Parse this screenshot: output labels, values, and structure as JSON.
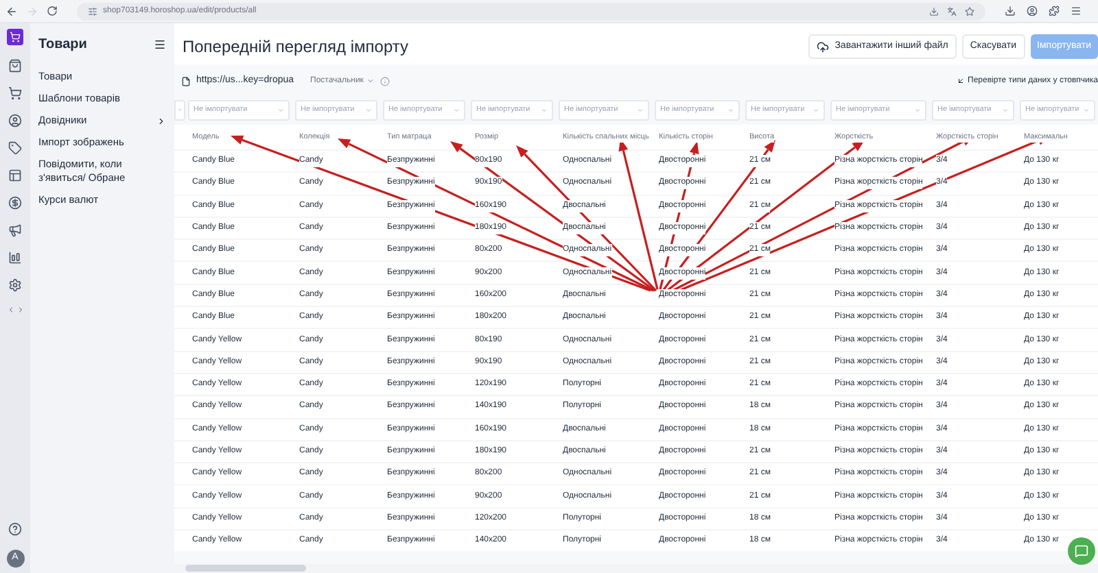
{
  "browser": {
    "url": "shop703149.horoshop.ua/edit/products/all"
  },
  "sidebar": {
    "title": "Товари",
    "items": [
      {
        "label": "Товари",
        "expandable": false
      },
      {
        "label": "Шаблони товарів",
        "expandable": false
      },
      {
        "label": "Довідники",
        "expandable": true
      },
      {
        "label": "Імпорт зображень",
        "expandable": false
      },
      {
        "label": "Повідомити, коли з'явиться/ Обране",
        "expandable": false
      },
      {
        "label": "Курси валют",
        "expandable": false
      }
    ]
  },
  "user": {
    "initial": "A"
  },
  "page": {
    "title": "Попередній перегляд імпорту",
    "buttons": [
      {
        "label": "Завантажити інший файл",
        "kind": "upload",
        "disabled": false
      },
      {
        "label": "Скасувати",
        "kind": "secondary",
        "disabled": false
      },
      {
        "label": "Імпортувати",
        "kind": "primary",
        "disabled": true
      }
    ]
  },
  "toolbar": {
    "file": "https://us...key=dropua",
    "supplier": "Постачальник",
    "hint": "Перевірте типи даних у стовпчика"
  },
  "table": {
    "columns": [
      {
        "name": "Модель",
        "mapping": "Не імпортувати"
      },
      {
        "name": "Колекція",
        "mapping": "Не імпортувати"
      },
      {
        "name": "Тип матраца",
        "mapping": "Не імпортувати"
      },
      {
        "name": "Розмір",
        "mapping": "Не імпортувати"
      },
      {
        "name": "Кількість спальних місць",
        "mapping": "Не імпортувати"
      },
      {
        "name": "Кількість сторін",
        "mapping": "Не імпортувати"
      },
      {
        "name": "Висота",
        "mapping": "Не імпортувати"
      },
      {
        "name": "Жорсткість",
        "mapping": "Не імпортувати"
      },
      {
        "name": "Жорсткість сторін",
        "mapping": "Не імпортувати"
      },
      {
        "name": "Максимальн",
        "mapping": "Не імпортувати"
      }
    ],
    "rows": [
      [
        "Candy Blue",
        "Candy",
        "Безпружинні",
        "80x190",
        "Односпальні",
        "Двосторонні",
        "21 см",
        "Різна жорсткість сторін",
        "3/4",
        "До 130 кг"
      ],
      [
        "Candy Blue",
        "Candy",
        "Безпружинні",
        "90x190",
        "Односпальні",
        "Двосторонні",
        "21 см",
        "Різна жорсткість сторін",
        "3/4",
        "До 130 кг"
      ],
      [
        "Candy Blue",
        "Candy",
        "Безпружинні",
        "160x190",
        "Двоспальні",
        "Двосторонні",
        "21 см",
        "Різна жорсткість сторін",
        "3/4",
        "До 130 кг"
      ],
      [
        "Candy Blue",
        "Candy",
        "Безпружинні",
        "180x190",
        "Двоспальні",
        "Двосторонні",
        "21 см",
        "Різна жорсткість сторін",
        "3/4",
        "До 130 кг"
      ],
      [
        "Candy Blue",
        "Candy",
        "Безпружинні",
        "80x200",
        "Односпальні",
        "Двосторонні",
        "21 см",
        "Різна жорсткість сторін",
        "3/4",
        "До 130 кг"
      ],
      [
        "Candy Blue",
        "Candy",
        "Безпружинні",
        "90x200",
        "Односпальні",
        "Двосторонні",
        "21 см",
        "Різна жорсткість сторін",
        "3/4",
        "До 130 кг"
      ],
      [
        "Candy Blue",
        "Candy",
        "Безпружинні",
        "160x200",
        "Двоспальні",
        "Двосторонні",
        "21 см",
        "Різна жорсткість сторін",
        "3/4",
        "До 130 кг"
      ],
      [
        "Candy Blue",
        "Candy",
        "Безпружинні",
        "180x200",
        "Двоспальні",
        "Двосторонні",
        "21 см",
        "Різна жорсткість сторін",
        "3/4",
        "До 130 кг"
      ],
      [
        "Candy Yellow",
        "Candy",
        "Безпружинні",
        "80x190",
        "Односпальні",
        "Двосторонні",
        "21 см",
        "Різна жорсткість сторін",
        "3/4",
        "До 130 кг"
      ],
      [
        "Candy Yellow",
        "Candy",
        "Безпружинні",
        "90x190",
        "Односпальні",
        "Двосторонні",
        "21 см",
        "Різна жорсткість сторін",
        "3/4",
        "До 130 кг"
      ],
      [
        "Candy Yellow",
        "Candy",
        "Безпружинні",
        "120x190",
        "Полуторні",
        "Двосторонні",
        "21 см",
        "Різна жорсткість сторін",
        "3/4",
        "До 130 кг"
      ],
      [
        "Candy Yellow",
        "Candy",
        "Безпружинні",
        "140x190",
        "Полуторні",
        "Двосторонні",
        "18 см",
        "Різна жорсткість сторін",
        "3/4",
        "До 130 кг"
      ],
      [
        "Candy Yellow",
        "Candy",
        "Безпружинні",
        "160x190",
        "Двоспальні",
        "Двосторонні",
        "18 см",
        "Різна жорсткість сторін",
        "3/4",
        "До 130 кг"
      ],
      [
        "Candy Yellow",
        "Candy",
        "Безпружинні",
        "180x190",
        "Двоспальні",
        "Двосторонні",
        "21 см",
        "Різна жорсткість сторін",
        "3/4",
        "До 130 кг"
      ],
      [
        "Candy Yellow",
        "Candy",
        "Безпружинні",
        "80x200",
        "Односпальні",
        "Двосторонні",
        "21 см",
        "Різна жорсткість сторін",
        "3/4",
        "До 130 кг"
      ],
      [
        "Candy Yellow",
        "Candy",
        "Безпружинні",
        "90x200",
        "Односпальні",
        "Двосторонні",
        "21 см",
        "Різна жорсткість сторін",
        "3/4",
        "До 130 кг"
      ],
      [
        "Candy Yellow",
        "Candy",
        "Безпружинні",
        "120x200",
        "Полуторні",
        "Двосторонні",
        "18 см",
        "Різна жорсткість сторін",
        "3/4",
        "До 130 кг"
      ],
      [
        "Candy Yellow",
        "Candy",
        "Безпружинні",
        "140x200",
        "Полуторні",
        "Двосторонні",
        "18 см",
        "Різна жорсткість сторін",
        "3/4",
        "До 130 кг"
      ]
    ]
  }
}
